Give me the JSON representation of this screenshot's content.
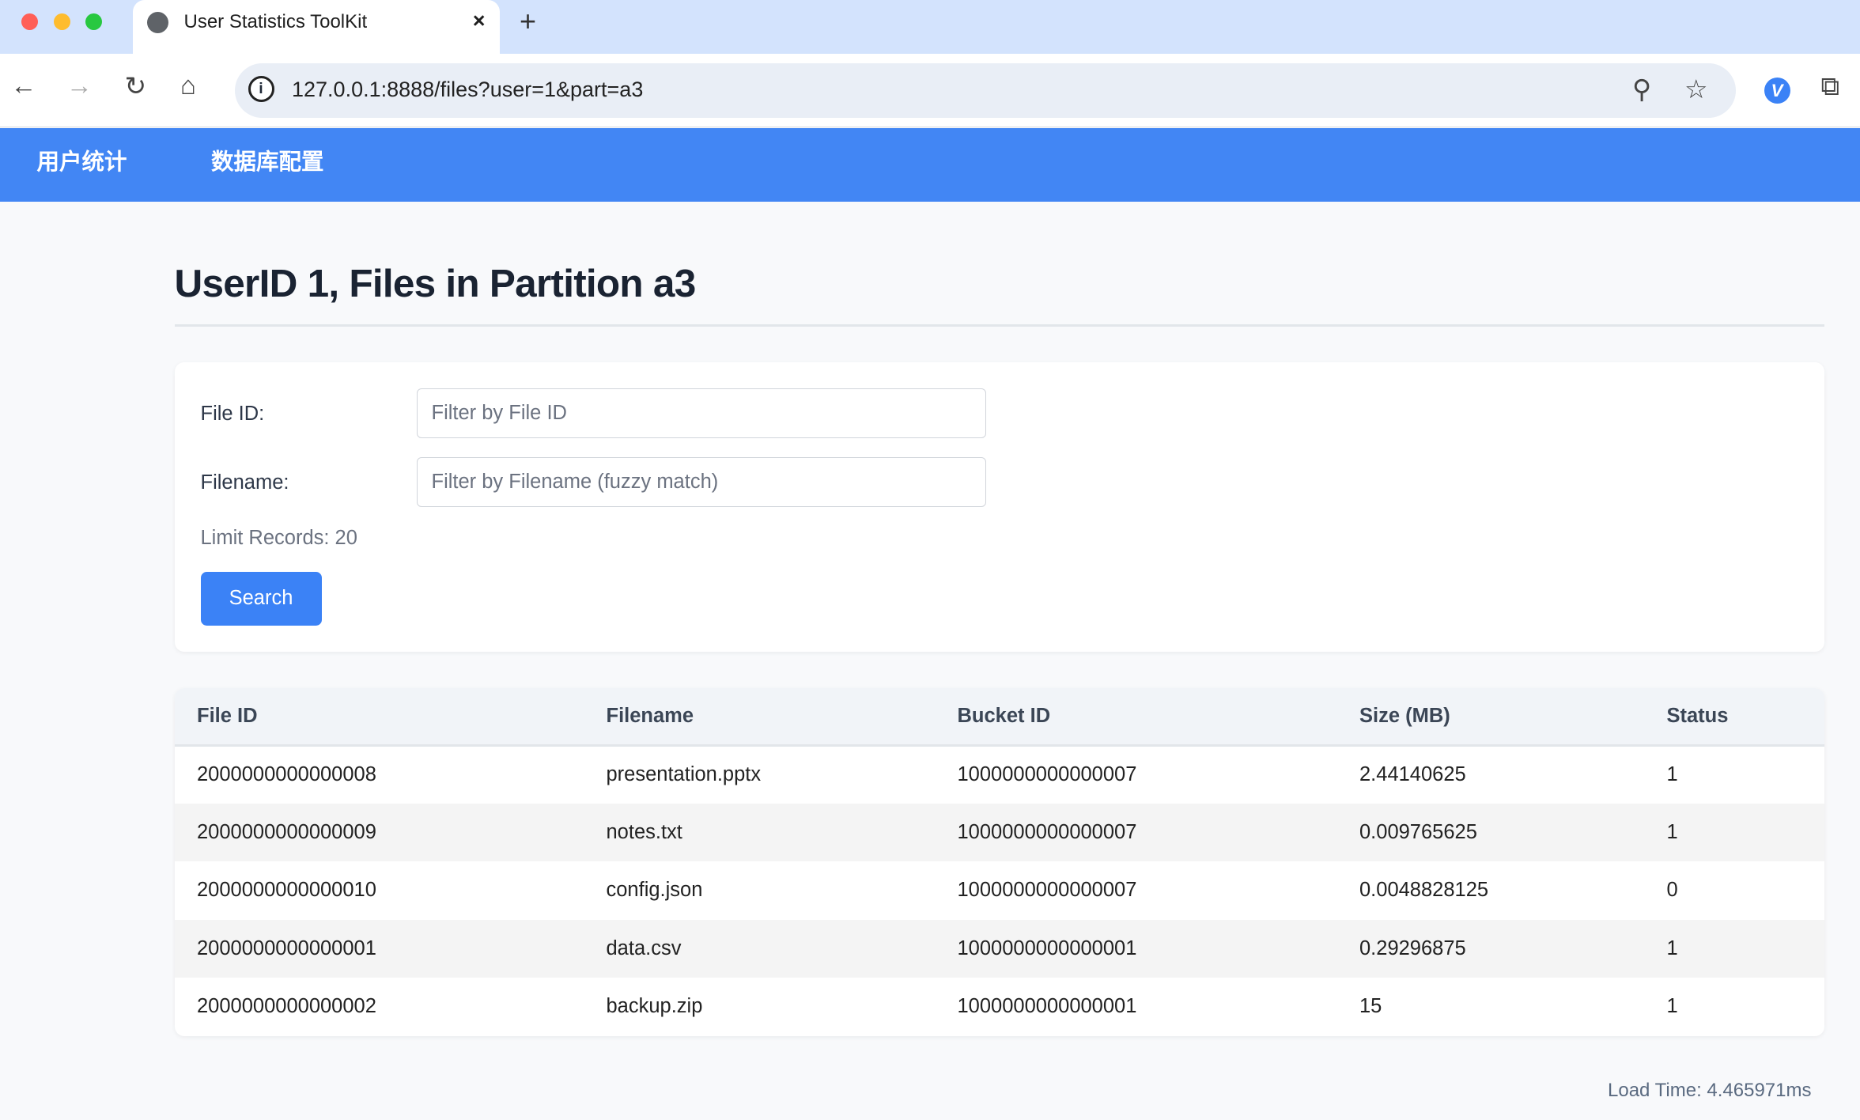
{
  "browser": {
    "tab_title": "User Statistics ToolKit",
    "url": "127.0.0.1:8888/files?user=1&part=a3",
    "close": "×",
    "new_tab": "+"
  },
  "nav": {
    "items": [
      "用户统计",
      "数据库配置"
    ]
  },
  "page": {
    "title": "UserID 1, Files in Partition a3"
  },
  "filters": {
    "file_id_label": "File ID:",
    "file_id_placeholder": "Filter by File ID",
    "filename_label": "Filename:",
    "filename_placeholder": "Filter by Filename (fuzzy match)",
    "limit_label": "Limit Records: 20",
    "search_label": "Search"
  },
  "table": {
    "headers": [
      "File ID",
      "Filename",
      "Bucket ID",
      "Size (MB)",
      "Status"
    ],
    "rows": [
      [
        "2000000000000008",
        "presentation.pptx",
        "1000000000000007",
        "2.44140625",
        "1"
      ],
      [
        "2000000000000009",
        "notes.txt",
        "1000000000000007",
        "0.009765625",
        "1"
      ],
      [
        "2000000000000010",
        "config.json",
        "1000000000000007",
        "0.0048828125",
        "0"
      ],
      [
        "2000000000000001",
        "data.csv",
        "1000000000000001",
        "0.29296875",
        "1"
      ],
      [
        "2000000000000002",
        "backup.zip",
        "1000000000000001",
        "15",
        "1"
      ]
    ]
  },
  "footer": {
    "load_time": "Load Time: 4.465971ms"
  }
}
